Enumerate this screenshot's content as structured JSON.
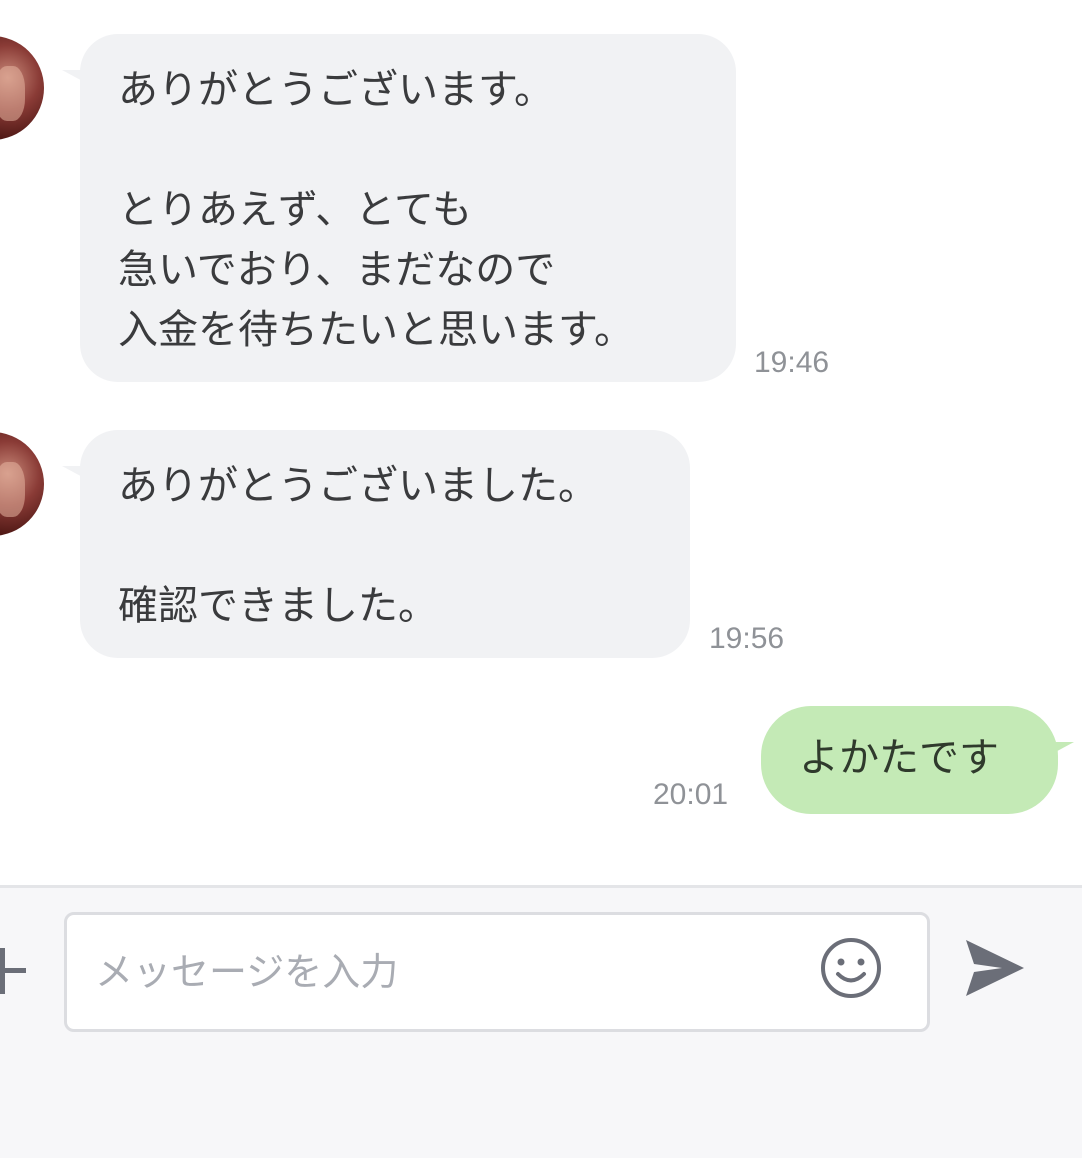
{
  "messages": [
    {
      "direction": "in",
      "text": "ありがとうございます。\n\nとりあえず、とても\n急いでおり、まだなので\n入金を待ちたいと思います。",
      "time": "19:46"
    },
    {
      "direction": "in",
      "text": "ありがとうございました。\n\n確認できました。",
      "time": "19:56"
    },
    {
      "direction": "out",
      "text": "よかたです",
      "time": "20:01"
    }
  ],
  "composer": {
    "placeholder": "メッセージを入力",
    "value": ""
  },
  "icons": {
    "attach": "plus-icon",
    "emoji": "smiley-face-icon",
    "send": "paper-plane-send-icon"
  },
  "colors": {
    "incoming_bubble": "#f1f2f4",
    "outgoing_bubble": "#c4eab6",
    "timestamp": "#8f9297",
    "icon": "#6b6e78",
    "composer_background": "#f7f7f9"
  }
}
